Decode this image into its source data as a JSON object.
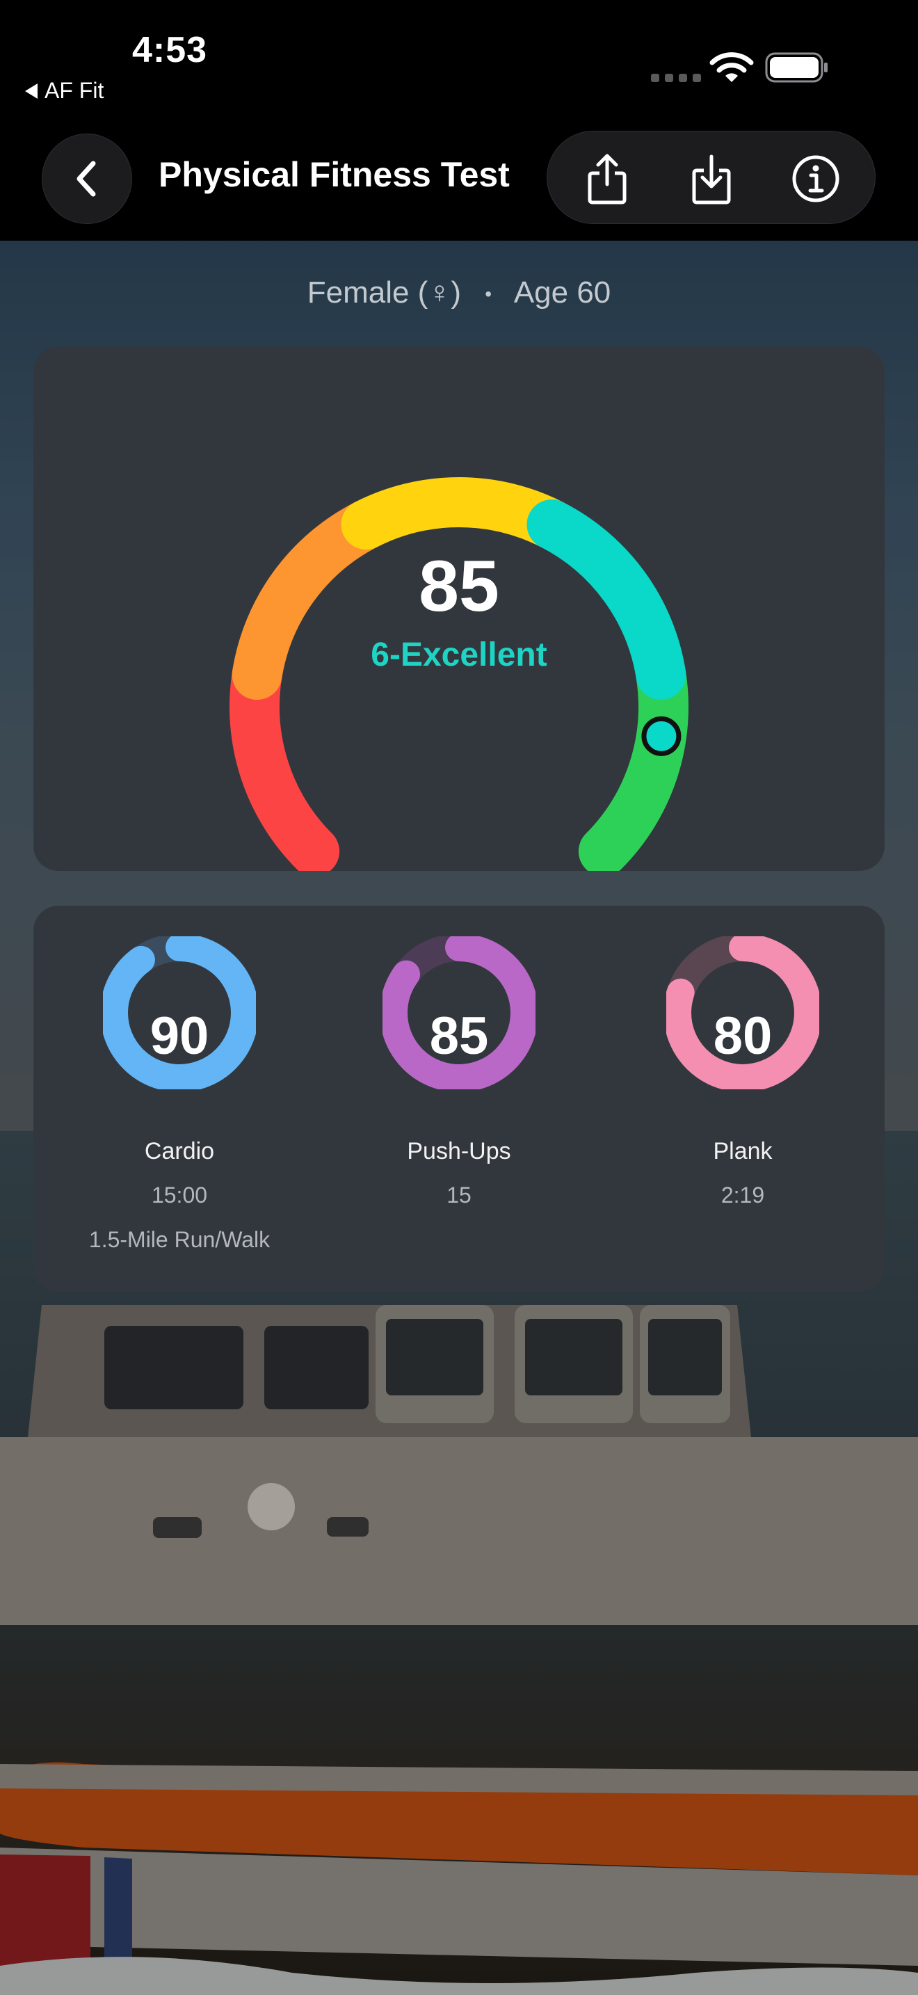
{
  "status_bar": {
    "time": "4:53",
    "back_app_label": "AF Fit"
  },
  "nav": {
    "title": "Physical Fitness Test"
  },
  "profile": {
    "sex_label": "Female (♀)",
    "separator": "•",
    "age_label": "Age 60"
  },
  "overall": {
    "score": "85",
    "score_value": 85,
    "rating": "6-Excellent",
    "gauge_segment_colors": [
      "#fc4445",
      "#fd9530",
      "#ffd40f",
      "#0ad8c8",
      "#2ed158"
    ],
    "indicator_color": "#0ad8c8"
  },
  "components": [
    {
      "score": "90",
      "score_value": 90,
      "label": "Cardio",
      "result": "15:00",
      "note": "1.5-Mile Run/Walk",
      "color": "#64b5f6"
    },
    {
      "score": "85",
      "score_value": 85,
      "label": "Push-Ups",
      "result": "15",
      "color": "#ba68c8"
    },
    {
      "score": "80",
      "score_value": 80,
      "label": "Plank",
      "result": "2:19",
      "color": "#f48fb1"
    }
  ]
}
